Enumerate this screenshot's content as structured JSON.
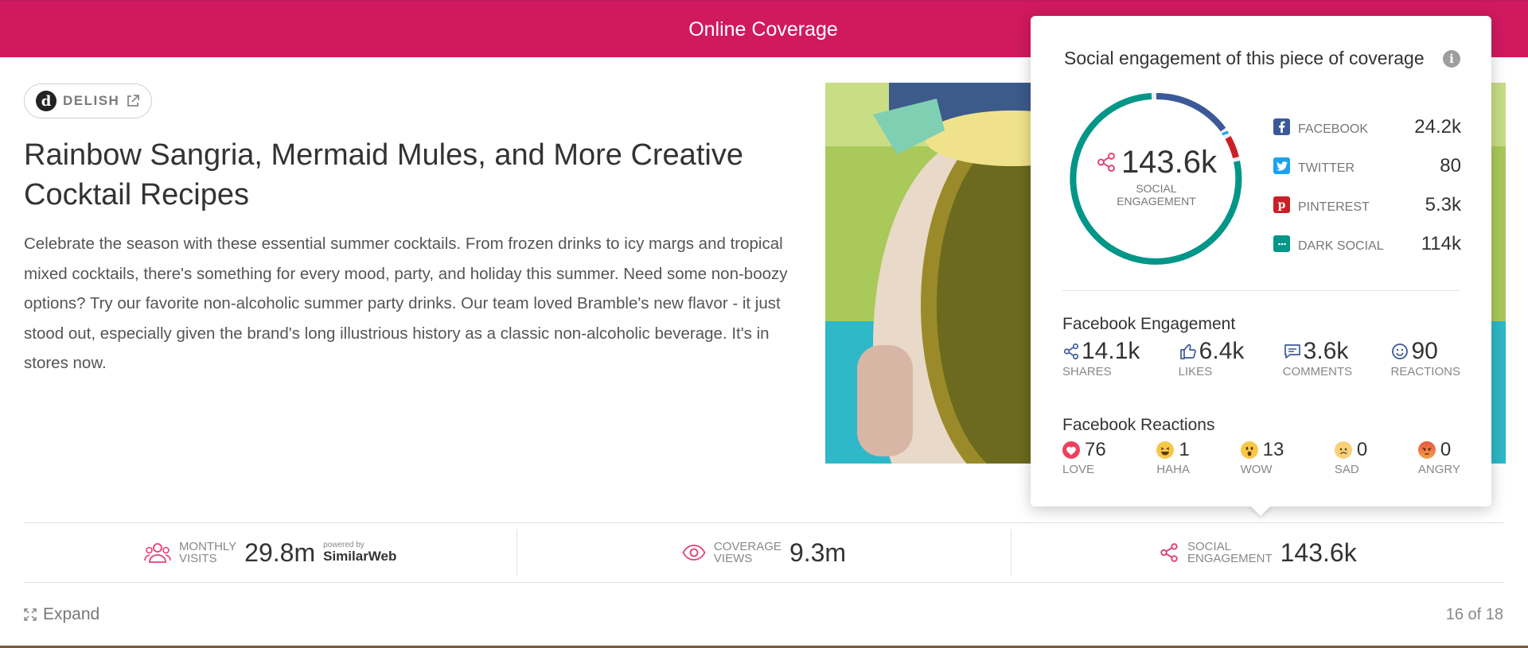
{
  "header": {
    "title": "Online Coverage"
  },
  "source": {
    "name": "DELISH",
    "logo_letter": "d"
  },
  "article": {
    "title": "Rainbow Sangria, Mermaid Mules, and More Creative Cocktail Recipes",
    "body": "Celebrate the season with these essential summer cocktails. From frozen drinks to icy margs and tropical mixed cocktails, there's something for every mood, party, and holiday this summer. Need some non-boozy options? Try our favorite non-alcoholic summer party drinks. Our team loved Bramble's new flavor - it just stood out, especially given the brand's long illustrious history as a classic non-alcoholic beverage. It's in stores now."
  },
  "popup": {
    "title": "Social engagement of this piece of coverage",
    "info_glyph": "i",
    "total_value": "143.6k",
    "total_label": "SOCIAL ENGAGEMENT",
    "breakdown": [
      {
        "label": "FACEBOOK",
        "value": "24.2k",
        "icon": "facebook-icon",
        "color": "#3b5998"
      },
      {
        "label": "TWITTER",
        "value": "80",
        "icon": "twitter-icon",
        "color": "#1da1f2"
      },
      {
        "label": "PINTEREST",
        "value": "5.3k",
        "icon": "pinterest-icon",
        "color": "#cb2027"
      },
      {
        "label": "DARK SOCIAL",
        "value": "114k",
        "icon": "dark-social-icon",
        "color": "#009688"
      }
    ],
    "facebook_engagement": {
      "title": "Facebook Engagement",
      "stats": [
        {
          "value": "14.1k",
          "label": "SHARES",
          "icon": "share-icon"
        },
        {
          "value": "6.4k",
          "label": "LIKES",
          "icon": "thumbs-up-icon"
        },
        {
          "value": "3.6k",
          "label": "COMMENTS",
          "icon": "comment-icon"
        },
        {
          "value": "90",
          "label": "REACTIONS",
          "icon": "smiley-icon"
        }
      ]
    },
    "facebook_reactions": {
      "title": "Facebook Reactions",
      "items": [
        {
          "value": "76",
          "label": "LOVE",
          "icon": "heart-icon"
        },
        {
          "value": "1",
          "label": "HAHA",
          "icon": "haha-emoji-icon"
        },
        {
          "value": "13",
          "label": "WOW",
          "icon": "wow-emoji-icon"
        },
        {
          "value": "0",
          "label": "SAD",
          "icon": "sad-emoji-icon"
        },
        {
          "value": "0",
          "label": "ANGRY",
          "icon": "angry-emoji-icon"
        }
      ]
    }
  },
  "metrics": {
    "monthly_visits": {
      "label_line1": "MONTHLY",
      "label_line2": "VISITS",
      "value": "29.8m",
      "powered_by": "powered by",
      "provider": "SimilarWeb"
    },
    "coverage_views": {
      "label_line1": "COVERAGE",
      "label_line2": "VIEWS",
      "value": "9.3m"
    },
    "social_engagement": {
      "label_line1": "SOCIAL",
      "label_line2": "ENGAGEMENT",
      "value": "143.6k"
    }
  },
  "footer": {
    "expand_label": "Expand",
    "pager": "16 of 18"
  },
  "colors": {
    "brand": "#d0195f",
    "accent_pink": "#e0407a",
    "facebook": "#3b5998",
    "twitter": "#1da1f2",
    "pinterest": "#cb2027",
    "dark_social": "#009688"
  }
}
